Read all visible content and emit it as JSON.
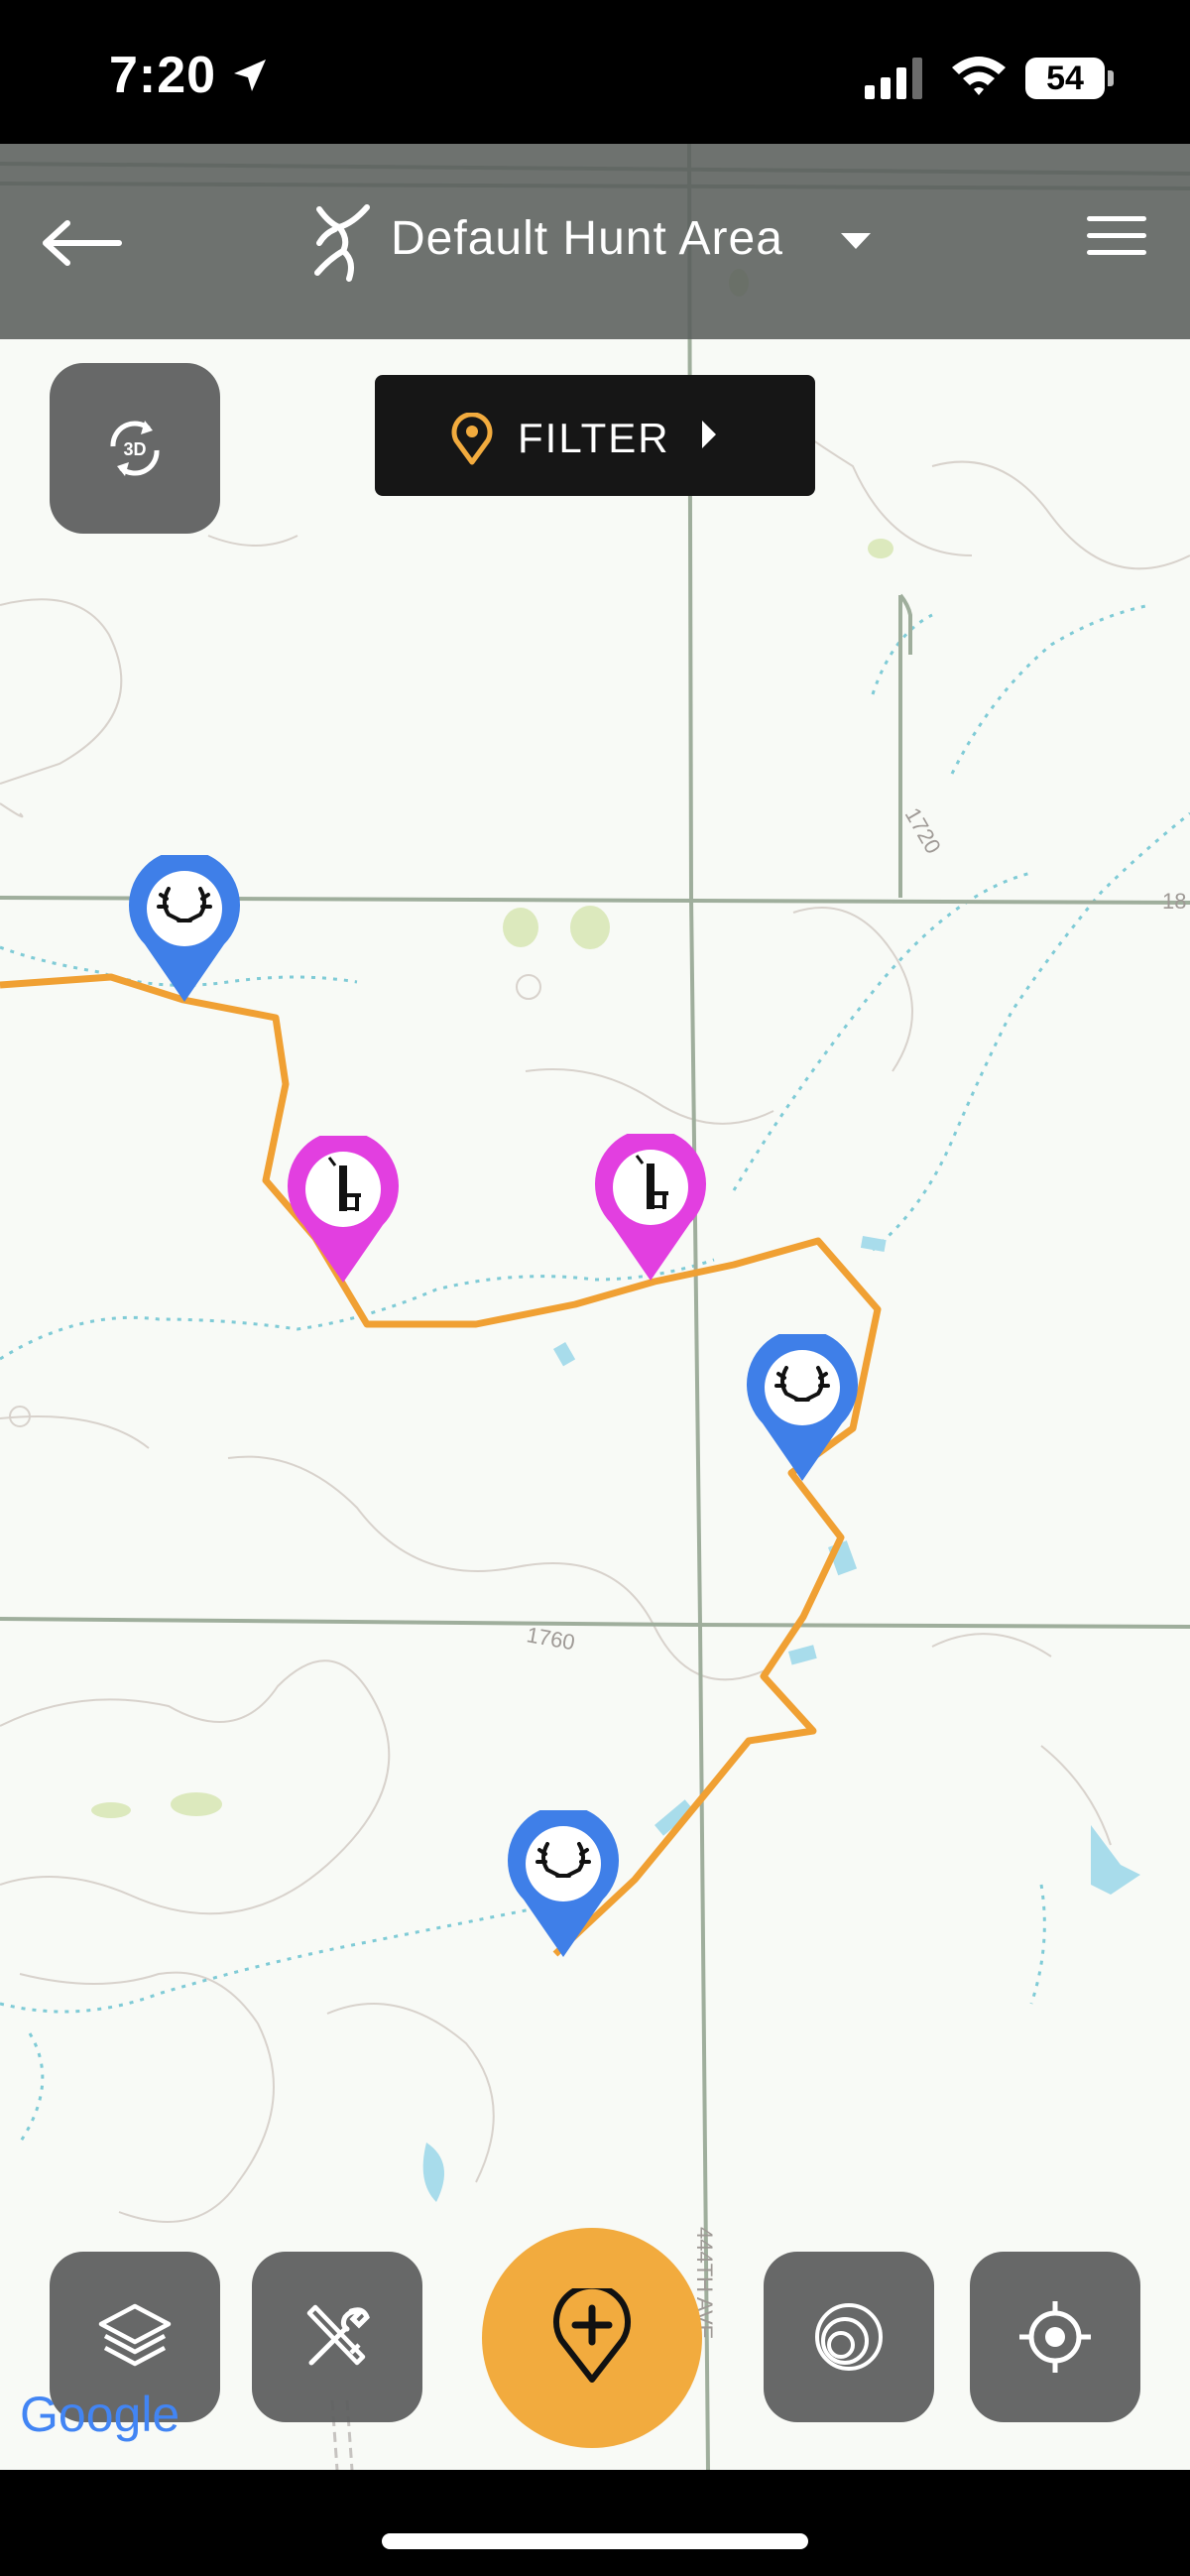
{
  "status_bar": {
    "time": "7:20",
    "battery": "54",
    "location_icon": "location-arrow-icon",
    "signal_icon": "cellular-signal-icon",
    "wifi_icon": "wifi-icon"
  },
  "header": {
    "title": "Default Hunt Area",
    "back_icon": "back-arrow-icon",
    "logo_icon": "deer-logo-icon",
    "dropdown_icon": "caret-down-icon",
    "menu_icon": "hamburger-menu-icon"
  },
  "controls": {
    "view_3d_label": "3D",
    "filter_label": "FILTER"
  },
  "map": {
    "contour_labels": [
      "1720",
      "1760"
    ],
    "grid_labels": [
      "18",
      "444TH AVE"
    ],
    "attribution": "Google",
    "markers": [
      {
        "type": "antler",
        "color": "#3f7fe8"
      },
      {
        "type": "stand",
        "color": "#e23fe0"
      },
      {
        "type": "stand",
        "color": "#e23fe0"
      },
      {
        "type": "antler",
        "color": "#3f7fe8"
      },
      {
        "type": "antler",
        "color": "#3f7fe8"
      }
    ],
    "track_color": "#f0a033"
  },
  "toolbar": {
    "buttons": [
      {
        "name": "layers",
        "icon": "layers-icon"
      },
      {
        "name": "tools",
        "icon": "tools-icon"
      },
      {
        "name": "add-marker",
        "icon": "add-pin-icon"
      },
      {
        "name": "range-rings",
        "icon": "range-rings-icon"
      },
      {
        "name": "locate",
        "icon": "crosshair-icon"
      }
    ]
  },
  "colors": {
    "accent": "#f2ab3e",
    "header_bg": "#5a5e5c",
    "marker_blue": "#3f7fe8",
    "marker_magenta": "#e23fe0"
  }
}
